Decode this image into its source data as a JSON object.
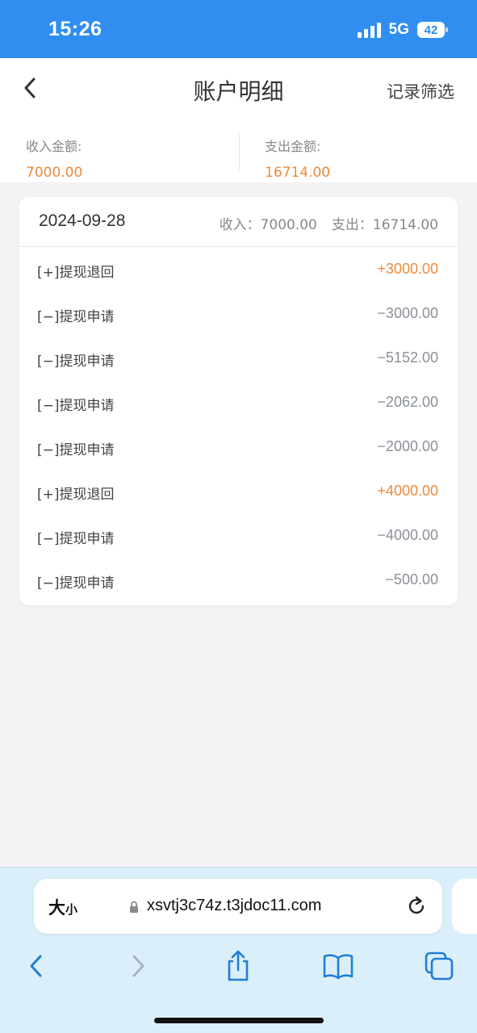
{
  "status_bar": {
    "time": "15:26",
    "network": "5G",
    "battery": "42"
  },
  "header": {
    "title": "账户明细",
    "filter_label": "记录筛选"
  },
  "summary": {
    "income_label": "收入金额:",
    "income_value": "7000.00",
    "expense_label": "支出金额:",
    "expense_value": "16714.00"
  },
  "day_group": {
    "date": "2024-09-28",
    "income_text": "收入：7000.00",
    "expense_text": "支出：16714.00",
    "records": [
      {
        "label": "[+]提现退回",
        "amount": "+3000.00",
        "type": "in"
      },
      {
        "label": "[−]提现申请",
        "amount": "−3000.00",
        "type": "out"
      },
      {
        "label": "[−]提现申请",
        "amount": "−5152.00",
        "type": "out"
      },
      {
        "label": "[−]提现申请",
        "amount": "−2062.00",
        "type": "out"
      },
      {
        "label": "[−]提现申请",
        "amount": "−2000.00",
        "type": "out"
      },
      {
        "label": "[+]提现退回",
        "amount": "+4000.00",
        "type": "in"
      },
      {
        "label": "[−]提现申请",
        "amount": "−4000.00",
        "type": "out"
      },
      {
        "label": "[−]提现申请",
        "amount": "−500.00",
        "type": "out"
      }
    ]
  },
  "browser": {
    "text_size_big": "大",
    "text_size_small": "小",
    "url": "xsvtj3c74z.t3jdoc11.com"
  },
  "colors": {
    "status_bar": "#2f8ef0",
    "accent_orange": "#ee8a3a",
    "browser_bg": "#dbeffa",
    "icon_blue": "#1f7ed6"
  }
}
